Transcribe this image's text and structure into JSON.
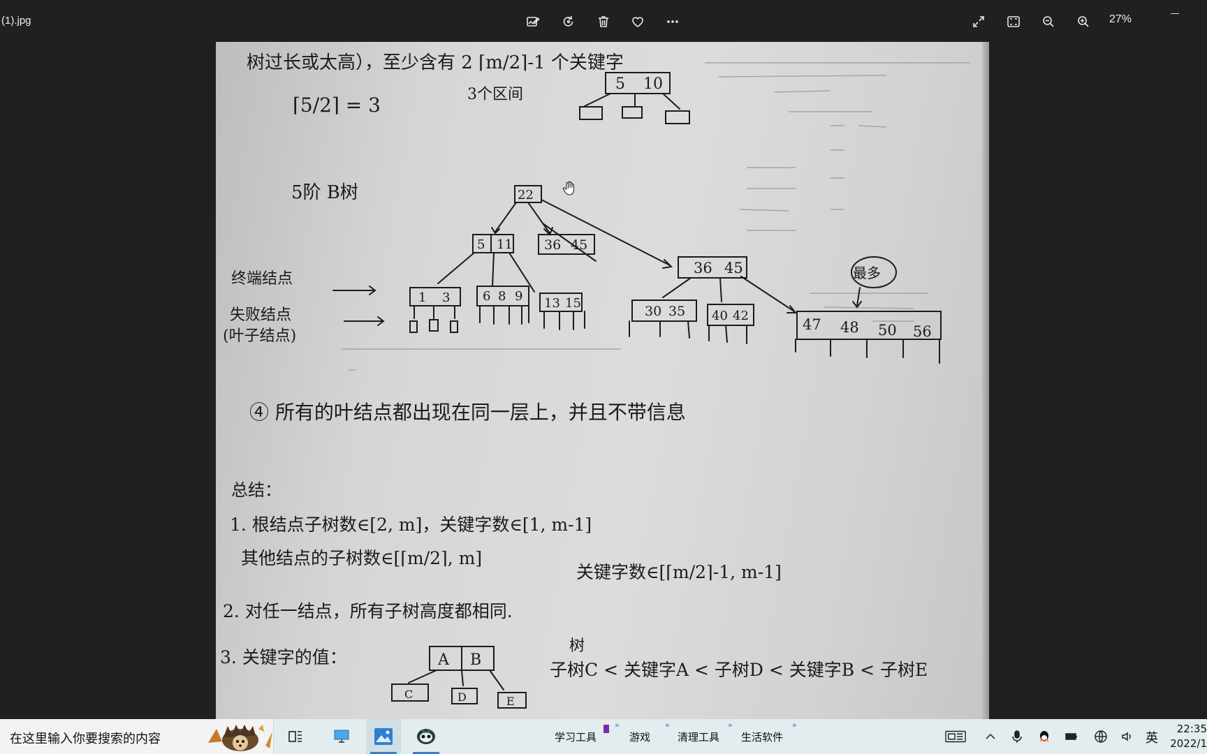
{
  "viewer": {
    "file_name": "(1).jpg",
    "zoom": "27%",
    "toolbar_icons": [
      "edit-image-icon",
      "rotate-icon",
      "delete-icon",
      "favorite-icon",
      "more-icon"
    ],
    "view_icons": [
      "fullscreen-icon",
      "fit-window-icon",
      "zoom-out-icon",
      "zoom-in-icon"
    ]
  },
  "photo": {
    "top_line": "树过长或太高），至少含有 2 ⌈m/2⌉-1 个关键字",
    "ceil_expr": "⌈5/2⌉ = 3",
    "intervals": "3个区间",
    "small_node": [
      "5",
      "10"
    ],
    "btree_label": "5阶 B树",
    "root": "22",
    "level1_left": [
      "5",
      "11"
    ],
    "level1_struck": [
      "36",
      "45"
    ],
    "level1_right": [
      "36",
      "45"
    ],
    "leaf_a": [
      "1",
      "3"
    ],
    "leaf_b": [
      "6",
      "8",
      "9"
    ],
    "leaf_c": [
      "13",
      "15"
    ],
    "leaf_d": [
      "30",
      "35"
    ],
    "leaf_e": [
      "40",
      "42"
    ],
    "leaf_f": [
      "47",
      "48",
      "50",
      "56"
    ],
    "most_label": "最多",
    "terminal_label": "终端结点",
    "failure_label": "失败结点",
    "leaf_label": "(叶子结点)",
    "rule4": "④ 所有的叶结点都出现在同一层上，并且不带信息",
    "summary_title": "总结：",
    "sum1a": "1. 根结点子树数∈[2, m]，关键字数∈[1, m-1]",
    "sum1b": "其他结点的子树数∈[⌈m/2⌉, m]",
    "sum1c": "关键字数∈[⌈m/2⌉-1, m-1]",
    "sum2": "2. 对任一结点，所有子树高度都相同.",
    "sum3": "3. 关键字的值：",
    "node_ab": [
      "A",
      "B"
    ],
    "children_cde": [
      "C",
      "D",
      "E"
    ],
    "inequality": "子树C < 关键字A < 子树D < 关键字B < 子树E",
    "inequality_above": "树"
  },
  "taskbar": {
    "search_placeholder": "在这里输入你要搜索的内容",
    "toolbars": [
      "学习工具",
      "游戏",
      "清理工具",
      "生活软件"
    ],
    "ime": "英",
    "time": "22:35",
    "date": "2022/1"
  }
}
